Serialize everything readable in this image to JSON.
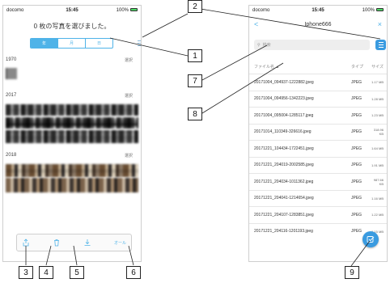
{
  "left_phone": {
    "status": {
      "carrier": "docomo",
      "time": "15:45",
      "battery": "100%"
    },
    "title": "0 枚の写真を選びました。",
    "segments": [
      {
        "label": "年",
        "active": true
      },
      {
        "label": "月",
        "active": false
      },
      {
        "label": "日",
        "active": false
      }
    ],
    "sections": [
      {
        "year": "1970",
        "select": "選択"
      },
      {
        "year": "2017",
        "select": "選択"
      },
      {
        "year": "2018",
        "select": "選択"
      }
    ],
    "toolbar": {
      "all_label": "オール"
    }
  },
  "right_phone": {
    "status": {
      "carrier": "docomo",
      "time": "15:45",
      "battery": "100%"
    },
    "nav": {
      "back": "<",
      "title": "Iphone666",
      "close": "×"
    },
    "search_placeholder": "検索",
    "header": {
      "name": "ファイル名",
      "type": "タイプ",
      "size": "サイズ"
    },
    "files": [
      {
        "name": "20171004_094937-1222882.jpeg",
        "type": "JPEG",
        "size": "1.17 MB"
      },
      {
        "name": "20171004_094956-1342223.jpeg",
        "type": "JPEG",
        "size": "1.28 MB"
      },
      {
        "name": "20171004_095004-1285117.jpeg",
        "type": "JPEG",
        "size": "1.23 MB"
      },
      {
        "name": "20171014_110349-326616.jpeg",
        "type": "JPEG",
        "size": "318.96 KB"
      },
      {
        "name": "20171221_104434-1722451.jpeg",
        "type": "JPEG",
        "size": "1.64 MB"
      },
      {
        "name": "20171221_204019-2002585.jpeg",
        "type": "JPEG",
        "size": "1.91 MB"
      },
      {
        "name": "20171221_204034-1011362.jpeg",
        "type": "JPEG",
        "size": "987.66 KB"
      },
      {
        "name": "20171221_204041-1214654.jpeg",
        "type": "JPEG",
        "size": "1.16 MB"
      },
      {
        "name": "20171221_204107-1283851.jpeg",
        "type": "JPEG",
        "size": "1.22 MB"
      },
      {
        "name": "20171221_204116-1201193.jpeg",
        "type": "JPEG",
        "size": "1.15 MB"
      }
    ]
  },
  "callouts": [
    "1",
    "2",
    "3",
    "4",
    "5",
    "6",
    "7",
    "8",
    "9"
  ],
  "colors": {
    "accent": "#3a9be0",
    "segment": "#4fb3e8"
  }
}
